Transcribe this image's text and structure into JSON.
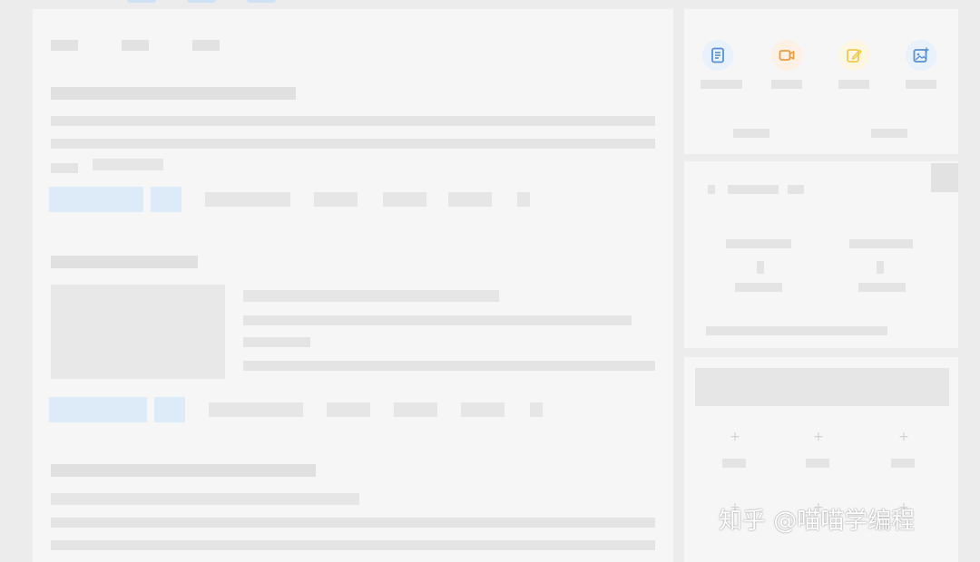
{
  "colors": {
    "background": "#ececec",
    "card": "#f6f6f6",
    "accent_blue": "#5a8fd1",
    "accent_orange": "#f09a3e",
    "accent_yellow": "#f1c94a"
  },
  "quick_actions": {
    "icons": [
      "document-icon",
      "video-icon",
      "edit-icon",
      "image-add-icon"
    ]
  },
  "watermark": {
    "text": "知乎 @喵喵学编程"
  }
}
